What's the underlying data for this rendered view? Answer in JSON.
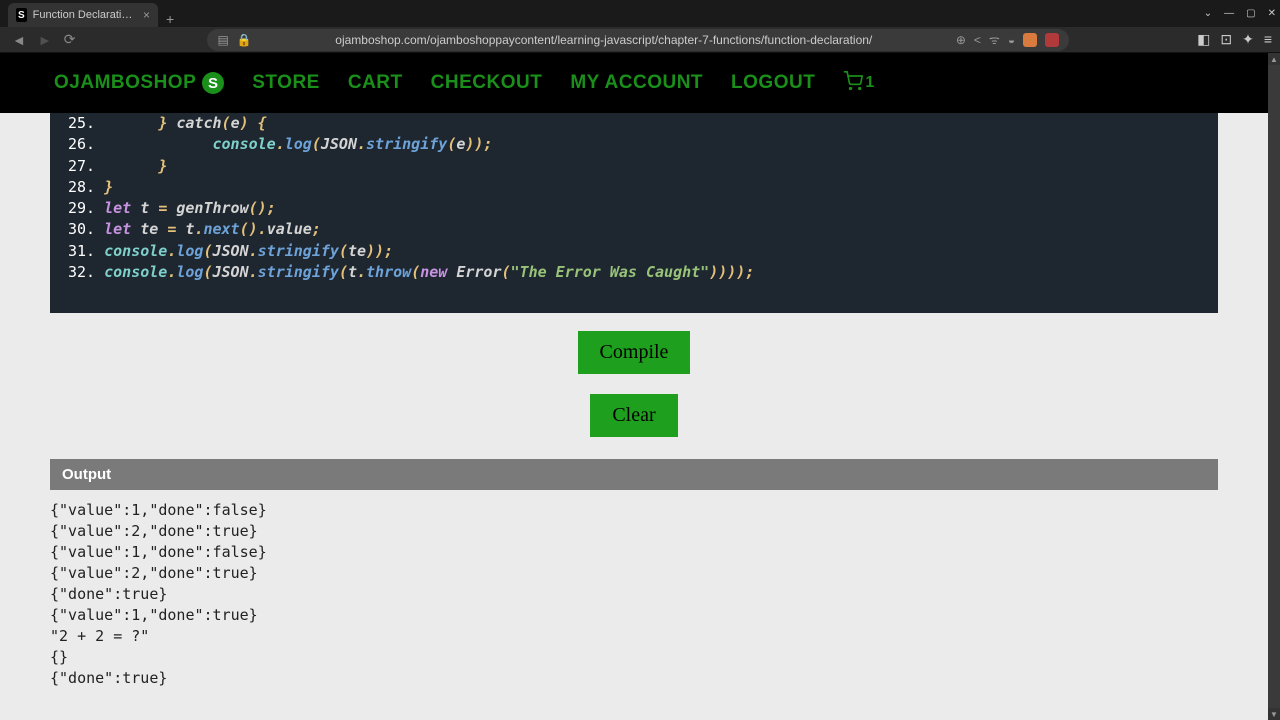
{
  "browser": {
    "tab_title": "Function Declaration - Ojam",
    "url": "ojamboshop.com/ojamboshoppaycontent/learning-javascript/chapter-7-functions/function-declaration/"
  },
  "header": {
    "logo_text": "OJAMBOSHOP",
    "logo_badge": "S",
    "nav": [
      "STORE",
      "CART",
      "CHECKOUT",
      "MY ACCOUNT",
      "LOGOUT"
    ],
    "cart_count": "1"
  },
  "code": {
    "lines": [
      {
        "num": "25.",
        "segments": [
          {
            "t": "      ",
            "c": ""
          },
          {
            "t": "}",
            "c": "pn"
          },
          {
            "t": " catch",
            "c": "id"
          },
          {
            "t": "(",
            "c": "pn"
          },
          {
            "t": "e",
            "c": "id"
          },
          {
            "t": ")",
            "c": "pn"
          },
          {
            "t": " ",
            "c": ""
          },
          {
            "t": "{",
            "c": "pn"
          }
        ]
      },
      {
        "num": "26.",
        "segments": [
          {
            "t": "            ",
            "c": ""
          },
          {
            "t": "console",
            "c": "cls"
          },
          {
            "t": ".",
            "c": "pn"
          },
          {
            "t": "log",
            "c": "fn"
          },
          {
            "t": "(",
            "c": "pn"
          },
          {
            "t": "JSON",
            "c": "id"
          },
          {
            "t": ".",
            "c": "pn"
          },
          {
            "t": "stringify",
            "c": "fn"
          },
          {
            "t": "(",
            "c": "pn"
          },
          {
            "t": "e",
            "c": "id"
          },
          {
            "t": "))",
            "c": "pn"
          },
          {
            "t": ";",
            "c": "pn"
          }
        ]
      },
      {
        "num": "27.",
        "segments": [
          {
            "t": "      ",
            "c": ""
          },
          {
            "t": "}",
            "c": "pn"
          }
        ]
      },
      {
        "num": "28.",
        "segments": [
          {
            "t": "}",
            "c": "pn"
          }
        ]
      },
      {
        "num": "29.",
        "segments": [
          {
            "t": "let",
            "c": "kw"
          },
          {
            "t": " t ",
            "c": "id"
          },
          {
            "t": "=",
            "c": "pn"
          },
          {
            "t": " genThrow",
            "c": "id"
          },
          {
            "t": "()",
            "c": "pn"
          },
          {
            "t": ";",
            "c": "pn"
          }
        ]
      },
      {
        "num": "30.",
        "segments": [
          {
            "t": "let",
            "c": "kw"
          },
          {
            "t": " te ",
            "c": "id"
          },
          {
            "t": "=",
            "c": "pn"
          },
          {
            "t": " t",
            "c": "id"
          },
          {
            "t": ".",
            "c": "pn"
          },
          {
            "t": "next",
            "c": "fn"
          },
          {
            "t": "()",
            "c": "pn"
          },
          {
            "t": ".",
            "c": "pn"
          },
          {
            "t": "value",
            "c": "id"
          },
          {
            "t": ";",
            "c": "pn"
          }
        ]
      },
      {
        "num": "31.",
        "segments": [
          {
            "t": "console",
            "c": "cls"
          },
          {
            "t": ".",
            "c": "pn"
          },
          {
            "t": "log",
            "c": "fn"
          },
          {
            "t": "(",
            "c": "pn"
          },
          {
            "t": "JSON",
            "c": "id"
          },
          {
            "t": ".",
            "c": "pn"
          },
          {
            "t": "stringify",
            "c": "fn"
          },
          {
            "t": "(",
            "c": "pn"
          },
          {
            "t": "te",
            "c": "id"
          },
          {
            "t": "))",
            "c": "pn"
          },
          {
            "t": ";",
            "c": "pn"
          }
        ]
      },
      {
        "num": "32.",
        "segments": [
          {
            "t": "console",
            "c": "cls"
          },
          {
            "t": ".",
            "c": "pn"
          },
          {
            "t": "log",
            "c": "fn"
          },
          {
            "t": "(",
            "c": "pn"
          },
          {
            "t": "JSON",
            "c": "id"
          },
          {
            "t": ".",
            "c": "pn"
          },
          {
            "t": "stringify",
            "c": "fn"
          },
          {
            "t": "(",
            "c": "pn"
          },
          {
            "t": "t",
            "c": "id"
          },
          {
            "t": ".",
            "c": "pn"
          },
          {
            "t": "throw",
            "c": "fn"
          },
          {
            "t": "(",
            "c": "pn"
          },
          {
            "t": "new",
            "c": "kw"
          },
          {
            "t": " Error",
            "c": "id"
          },
          {
            "t": "(",
            "c": "pn"
          },
          {
            "t": "\"The Error Was Caught\"",
            "c": "str"
          },
          {
            "t": "))))",
            "c": "pn"
          },
          {
            "t": ";",
            "c": "pn"
          }
        ]
      }
    ]
  },
  "buttons": {
    "compile": "Compile",
    "clear": "Clear"
  },
  "output": {
    "header": "Output",
    "lines": [
      "{\"value\":1,\"done\":false}",
      "{\"value\":2,\"done\":true}",
      "{\"value\":1,\"done\":false}",
      "{\"value\":2,\"done\":true}",
      "{\"done\":true}",
      "{\"value\":1,\"done\":true}",
      "\"2 + 2 = ?\"",
      "{}",
      "{\"done\":true}"
    ]
  }
}
